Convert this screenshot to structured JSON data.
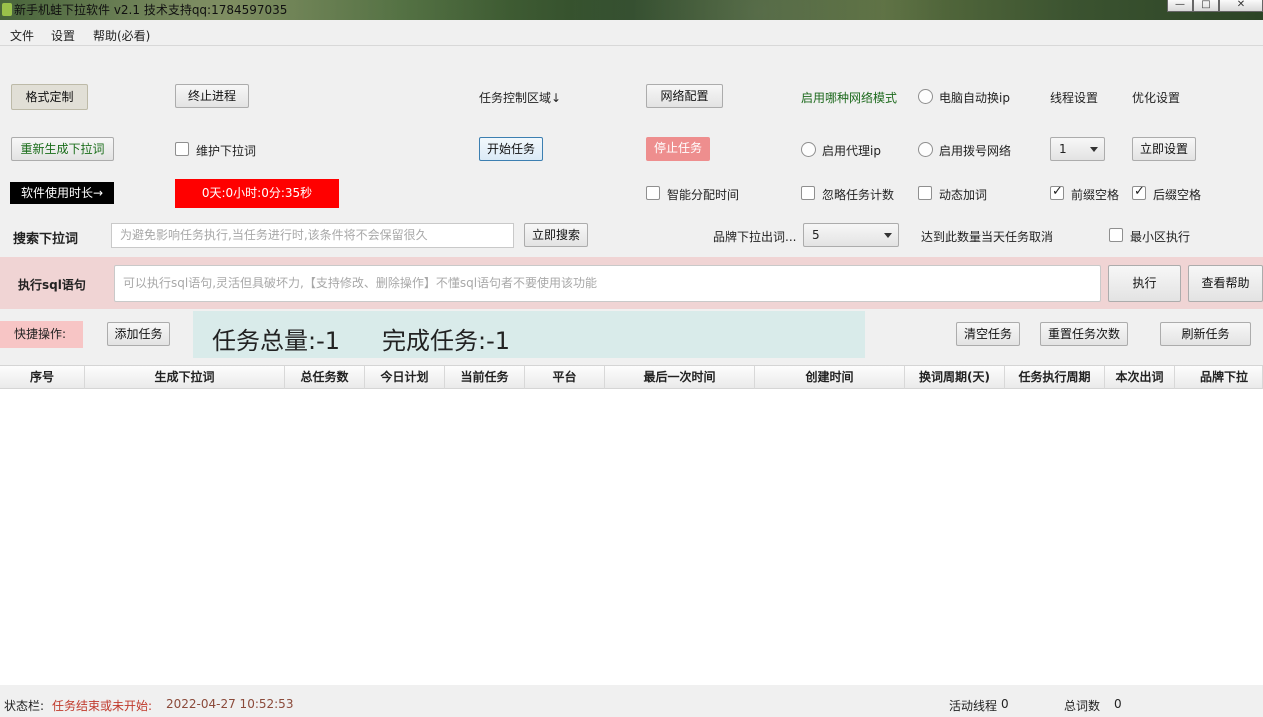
{
  "window": {
    "title": "新手机蛙下拉软件  v2.1     技术支持qq:1784597035",
    "min": "—",
    "max": "□",
    "close": "✕"
  },
  "menu": [
    "文件",
    "设置",
    "帮助(必看)"
  ],
  "controls": {
    "format_btn": "格式定制",
    "stop_process_btn": "终止进程",
    "task_area_label": "任务控制区域↓",
    "network_config_btn": "网络配置",
    "network_mode_label": "启用哪种网络模式",
    "auto_ip_label": "电脑自动换ip",
    "thread_settings_label": "线程设置",
    "optimize_label": "优化设置",
    "regen_btn": "重新生成下拉词",
    "maintain_label": "维护下拉词",
    "start_task_btn": "开始任务",
    "stop_task_btn": "停止任务",
    "proxy_label": "启用代理ip",
    "dialup_label": "启用拨号网络",
    "thread_value": "1",
    "apply_btn": "立即设置",
    "usage_time_label": "软件使用时长→",
    "usage_time_value": "0天:0小时:0分:35秒",
    "smart_time_label": "智能分配时间",
    "ignore_count_label": "忽略任务计数",
    "dynamic_word_label": "动态加词",
    "prefix_space_label": "前缀空格",
    "suffix_space_label": "后缀空格",
    "search_label": "搜索下拉词",
    "search_placeholder": "为避免影响任务执行,当任务进行时,该条件将不会保留很久",
    "search_btn": "立即搜索",
    "brand_label": "品牌下拉出词...",
    "brand_value": "5",
    "cancel_label": "达到此数量当天任务取消",
    "min_area_label": "最小区执行"
  },
  "sql": {
    "label": "执行sql语句",
    "placeholder": "可以执行sql语句,灵活但具破坏力,【支持修改、删除操作】不懂sql语句者不要使用该功能",
    "exec_btn": "执行",
    "help_btn": "查看帮助"
  },
  "quick": {
    "label": "快捷操作:",
    "add_btn": "添加任务",
    "total_tasks": "任务总量:-1",
    "done_tasks": "完成任务:-1",
    "clear_btn": "清空任务",
    "reset_btn": "重置任务次数",
    "refresh_btn": "刷新任务"
  },
  "table": {
    "columns": [
      "序号",
      "生成下拉词",
      "总任务数",
      "今日计划",
      "当前任务",
      "平台",
      "最后一次时间",
      "创建时间",
      "换词周期(天)",
      "任务执行周期",
      "本次出词",
      "品牌下拉"
    ]
  },
  "status": {
    "label": "状态栏:",
    "state": "任务结束或未开始:",
    "time": "2022-04-27 10:52:53",
    "threads_label": "活动线程",
    "threads_value": "0",
    "words_label": "总词数",
    "words_value": "0"
  }
}
